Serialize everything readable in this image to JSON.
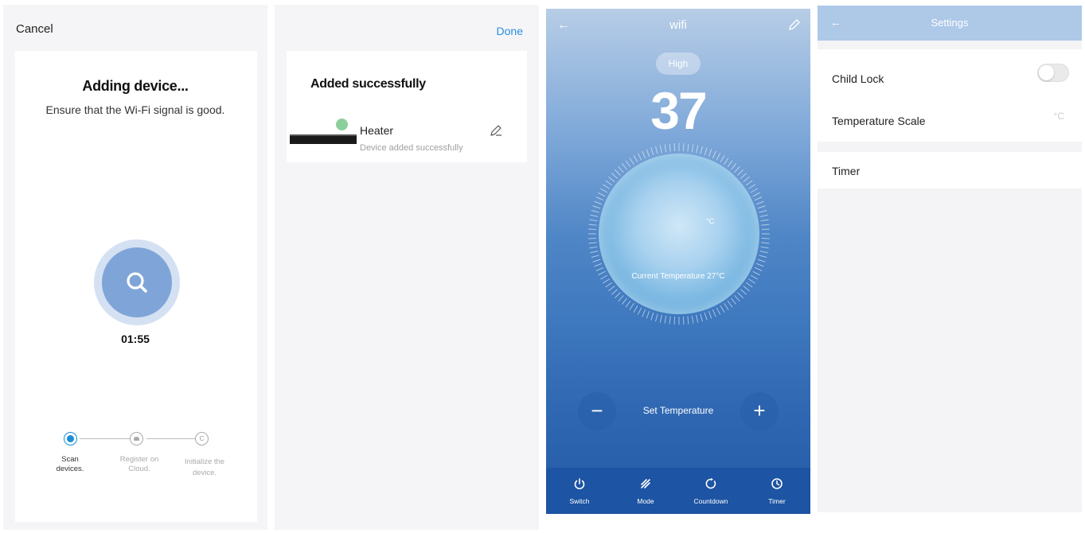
{
  "panel1": {
    "cancel_label": "Cancel",
    "title": "Adding device...",
    "subtitle": "Ensure that the Wi-Fi signal is good.",
    "countdown": "01:55",
    "steps": [
      {
        "line1": "Scan",
        "line2": "devices.",
        "state": "active"
      },
      {
        "line1": "Register on",
        "line2": "Cloud.",
        "state": "pending"
      },
      {
        "line1": "Initialize the",
        "line2": "device.",
        "state": "pending"
      }
    ],
    "icons": [
      "search-icon",
      "cloud-icon",
      "copyright-icon"
    ],
    "colors": {
      "accent": "#1a8ed8",
      "scan_ring": "#d4e1f2",
      "scan_disc": "#7fa5d8"
    }
  },
  "panel2": {
    "done_label": "Done",
    "title": "Added successfully",
    "device_name": "Heater",
    "device_status": "Device added successfully",
    "colors": {
      "accent": "#2a8ee0",
      "badge": "#8ccf9a"
    }
  },
  "panel3": {
    "header_title": "wifi",
    "mode_pill": "High",
    "set_temperature": "37",
    "temperature_unit": "°C",
    "current_temperature": "Current Temperature 27°C",
    "set_temperature_label": "Set Temperature",
    "minus_label": "−",
    "plus_label": "+",
    "nav": [
      {
        "label": "Switch",
        "icon": "power-icon"
      },
      {
        "label": "Mode",
        "icon": "mode-icon"
      },
      {
        "label": "Countdown",
        "icon": "countdown-icon"
      },
      {
        "label": "Timer",
        "icon": "clock-icon"
      }
    ],
    "colors": {
      "nav_bg": "#1d54a3",
      "sky_top": "#b7cde6",
      "sky_bottom": "#245aa5"
    }
  },
  "panel4": {
    "title": "Settings",
    "child_lock_label": "Child Lock",
    "child_lock_on": false,
    "temperature_scale_label": "Temperature Scale",
    "temperature_scale_value": "°C",
    "timer_label": "Timer",
    "colors": {
      "bar": "#aec8e8"
    }
  }
}
